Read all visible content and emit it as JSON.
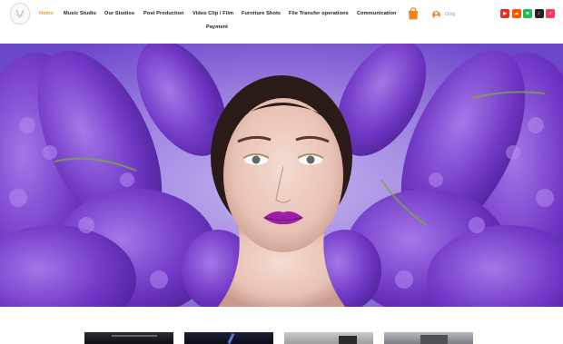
{
  "header": {
    "nav": [
      {
        "label": "Home",
        "active": true
      },
      {
        "label": "Music Studio",
        "active": false
      },
      {
        "label": "Our Studios",
        "active": false
      },
      {
        "label": "Post Production",
        "active": false
      },
      {
        "label": "Video Clip / Film",
        "active": false
      },
      {
        "label": "Furniture Shots",
        "active": false
      },
      {
        "label": "File Transfer operations",
        "active": false
      },
      {
        "label": "Communication",
        "active": false
      },
      {
        "label": "Payment",
        "active": false
      }
    ],
    "login_label": "Giriş",
    "cart_icon": "shopping-bag-icon",
    "socials": [
      {
        "name": "youtube-icon",
        "color": "#e52d27",
        "glyph": "▶"
      },
      {
        "name": "soundcloud-icon",
        "color": "#ff5500",
        "glyph": "☁"
      },
      {
        "name": "spotify-icon",
        "color": "#1db954",
        "glyph": "≋"
      },
      {
        "name": "tiktok-icon",
        "color": "#222222",
        "glyph": "♪"
      },
      {
        "name": "apple-music-icon",
        "color": "#fa3a5a",
        "glyph": "♫"
      }
    ]
  },
  "colors": {
    "accent": "#f39a1e",
    "hero_background": "#8a6ddc",
    "flowers": "#6a2ec0"
  },
  "hero": {
    "image": "model-with-purple-lupine-flowers"
  }
}
